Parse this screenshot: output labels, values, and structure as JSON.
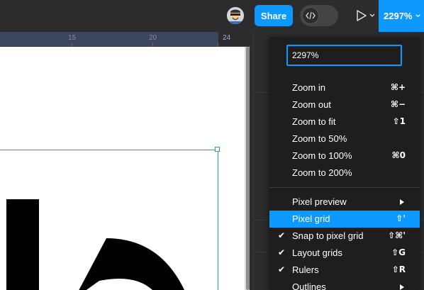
{
  "toolbar": {
    "share_label": "Share",
    "zoom_label": "2297%"
  },
  "ruler": {
    "labels": [
      "15",
      "20",
      "24"
    ]
  },
  "zoom_menu": {
    "input_value": "2297%",
    "items": [
      {
        "label": "Zoom in",
        "shortcut": "⌘+"
      },
      {
        "label": "Zoom out",
        "shortcut": "⌘−"
      },
      {
        "label": "Zoom to fit",
        "shortcut": "⇧1"
      },
      {
        "label": "Zoom to 50%",
        "shortcut": ""
      },
      {
        "label": "Zoom to 100%",
        "shortcut": "⌘0"
      },
      {
        "label": "Zoom to 200%",
        "shortcut": ""
      },
      {
        "label": "Pixel preview",
        "shortcut": ""
      },
      {
        "label": "Pixel grid",
        "shortcut": "⇧'"
      },
      {
        "label": "Snap to pixel grid",
        "shortcut": "⇧⌘'"
      },
      {
        "label": "Layout grids",
        "shortcut": "⇧G"
      },
      {
        "label": "Rulers",
        "shortcut": "⇧R"
      },
      {
        "label": "Outlines",
        "shortcut": ""
      }
    ]
  },
  "colors": {
    "accent": "#0d99ff",
    "menu_bg": "#1e1e1e",
    "toolbar_bg": "#2c2c2c"
  }
}
